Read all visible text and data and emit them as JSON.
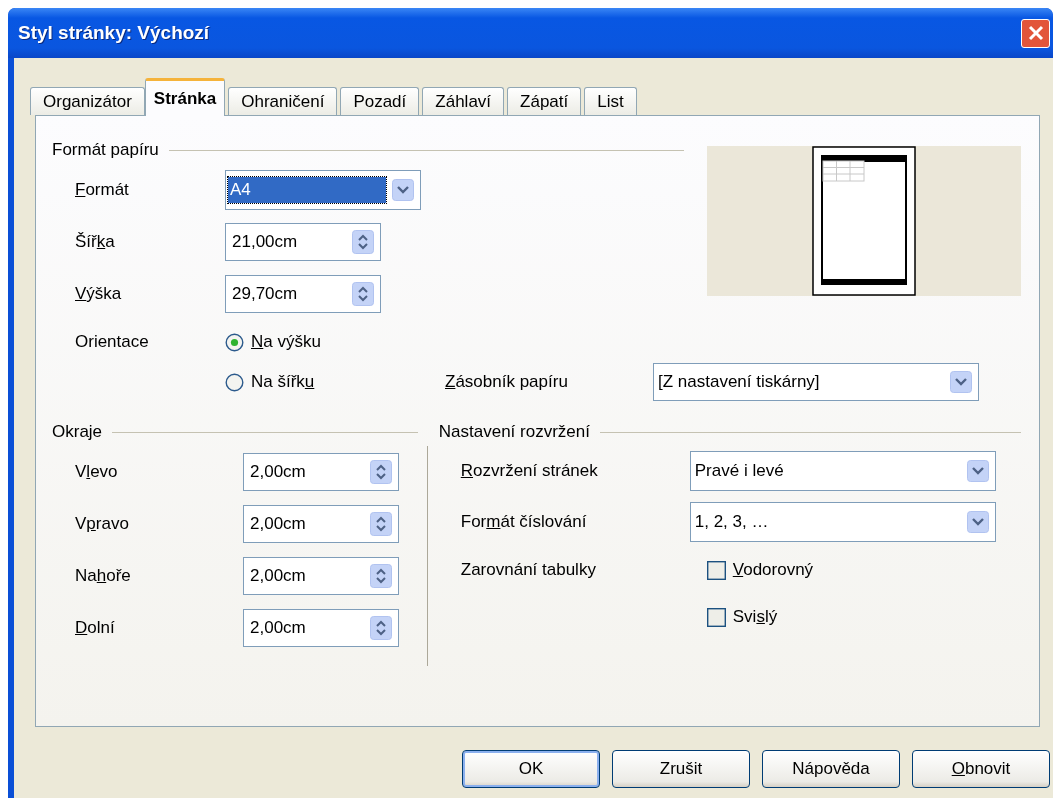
{
  "window": {
    "title": "Styl stránky: Výchozí"
  },
  "tabs": [
    {
      "label": "Organizátor",
      "selected": false
    },
    {
      "label": "Stránka",
      "selected": true
    },
    {
      "label": "Ohraničení",
      "selected": false
    },
    {
      "label": "Pozadí",
      "selected": false
    },
    {
      "label": "Záhlaví",
      "selected": false
    },
    {
      "label": "Zápatí",
      "selected": false
    },
    {
      "label": "List",
      "selected": false
    }
  ],
  "paper_format": {
    "title": "Formát papíru",
    "format": {
      "label": {
        "key": "F",
        "after": "ormát"
      },
      "value": "A4",
      "focused": true
    },
    "width": {
      "label": {
        "before": "Šíř",
        "key": "k",
        "after": "a"
      },
      "value": "21,00cm"
    },
    "height": {
      "label": {
        "key": "V",
        "after": "ýška"
      },
      "value": "29,70cm"
    },
    "orientation": {
      "label": "Orientace",
      "options": [
        {
          "label": {
            "key": "N",
            "after": "a výšku"
          },
          "selected": true
        },
        {
          "label": {
            "before": "Na šířk",
            "key": "u"
          },
          "selected": false
        }
      ]
    },
    "paper_tray": {
      "label": {
        "key": "Z",
        "after": "ásobník papíru"
      },
      "value": "[Z nastavení tiskárny]"
    }
  },
  "margins": {
    "title": "Okraje",
    "fields": [
      {
        "label": {
          "before": "V",
          "key": "l",
          "after": "evo"
        },
        "value": "2,00cm"
      },
      {
        "label": {
          "before": "V",
          "key": "p",
          "after": "ravo"
        },
        "value": "2,00cm"
      },
      {
        "label": {
          "before": "Na",
          "key": "h",
          "after": "oře"
        },
        "value": "2,00cm"
      },
      {
        "label": {
          "key": "D",
          "after": "olní"
        },
        "value": "2,00cm"
      }
    ]
  },
  "layout_settings": {
    "title": "Nastavení rozvržení",
    "page_layout": {
      "label": {
        "key": "R",
        "after": "ozvržení stránek"
      },
      "value": "Pravé i levé"
    },
    "numbering_format": {
      "label": {
        "before": "For",
        "key": "m",
        "after": "át číslování"
      },
      "value": "1, 2, 3, …"
    },
    "table_alignment": {
      "label": "Zarovnání tabulky",
      "options": [
        {
          "label": {
            "key": "V",
            "after": "odorovný"
          },
          "checked": false
        },
        {
          "label": {
            "before": "Svi",
            "key": "s",
            "after": "lý"
          },
          "checked": false
        }
      ]
    }
  },
  "buttons": [
    {
      "label": "OK",
      "default": true
    },
    {
      "label": "Zrušit",
      "default": false
    },
    {
      "label": "Nápověda",
      "default": false
    },
    {
      "label": {
        "key": "O",
        "after": "bnovit"
      },
      "default": false
    }
  ]
}
